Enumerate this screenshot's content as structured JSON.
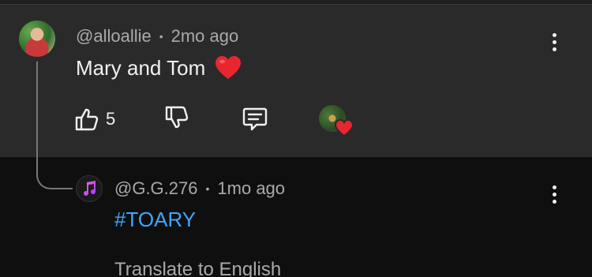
{
  "comment": {
    "author": "@alloallie",
    "separator": "•",
    "time": "2mo ago",
    "text": "Mary and Tom",
    "emoji": "heart",
    "like_count": "5",
    "icons": [
      "three-dots-icon",
      "thumbs-up-icon",
      "thumbs-down-icon",
      "reply-icon",
      "creator-heart-icon"
    ]
  },
  "reply": {
    "author": "@G.G.276",
    "separator": "•",
    "time": "1mo ago",
    "hashtag": "#TOARY",
    "translate_label": "Translate to English",
    "avatar_icon": "music-note-icon"
  },
  "colors": {
    "panel": "#2a2a2a",
    "background": "#0f0f0f",
    "link": "#3ea6ff",
    "heart": "#e8262f",
    "muted_text": "#aaaaaa"
  }
}
